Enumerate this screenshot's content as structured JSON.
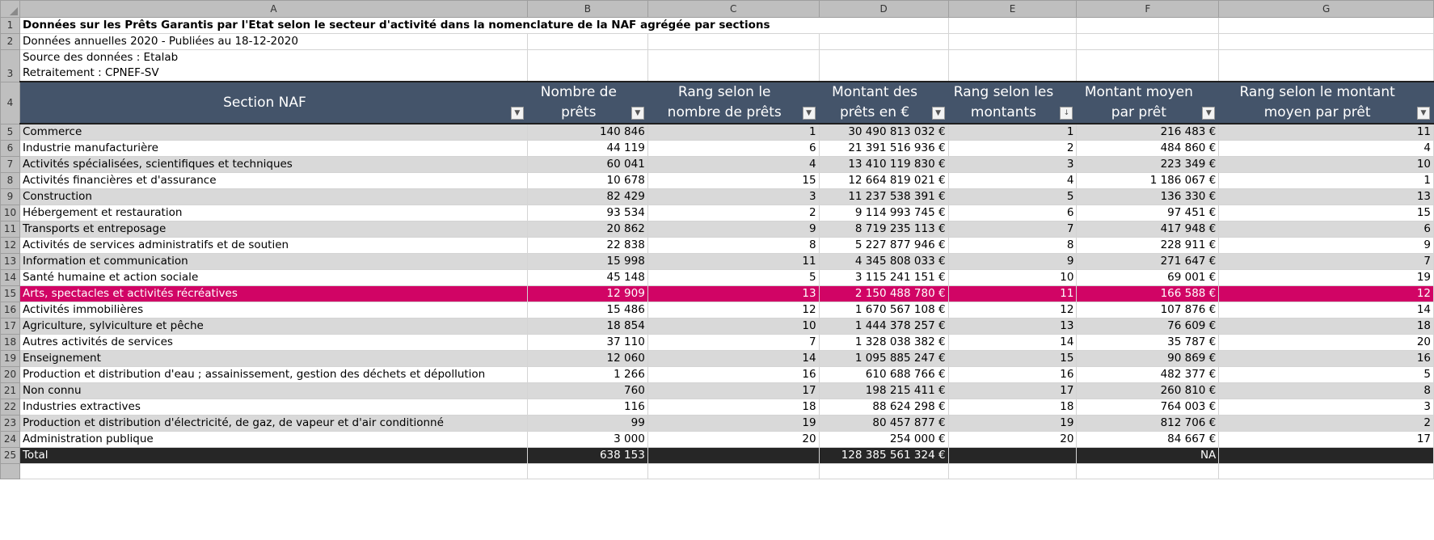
{
  "columns": [
    "A",
    "B",
    "C",
    "D",
    "E",
    "F",
    "G"
  ],
  "row_numbers": [
    "1",
    "2",
    "3",
    "4",
    "5",
    "6",
    "7",
    "8",
    "9",
    "10",
    "11",
    "12",
    "13",
    "14",
    "15",
    "16",
    "17",
    "18",
    "19",
    "20",
    "21",
    "22",
    "23",
    "24",
    "25",
    "26"
  ],
  "title": "Données sur les Prêts Garantis par l'Etat selon le secteur d'activité dans la nomenclature de la NAF agrégée par sections",
  "subtitle": "Données annuelles 2020 - Publiées au 18-12-2020",
  "source_line": "Source des données : Etalab",
  "retraitement_line": "Retraitement : CPNEF-SV",
  "headers": [
    "Section NAF",
    "Nombre de prêts",
    "Rang selon le nombre de prêts",
    "Montant des prêts en €",
    "Rang selon les montants",
    "Montant moyen par prêt",
    "Rang selon le montant moyen par prêt"
  ],
  "filter_icons": [
    "dropdown-arrow",
    "dropdown-arrow",
    "dropdown-arrow",
    "dropdown-arrow",
    "sort-descending",
    "dropdown-arrow",
    "dropdown-arrow"
  ],
  "rows": [
    {
      "section": "Commerce",
      "nombre": "140 846",
      "rang_nombre": "1",
      "montant": "30 490 813 032 €",
      "rang_montant": "1",
      "moyen": "216 483 €",
      "rang_moyen": "11"
    },
    {
      "section": "Industrie manufacturière",
      "nombre": "44 119",
      "rang_nombre": "6",
      "montant": "21 391 516 936 €",
      "rang_montant": "2",
      "moyen": "484 860 €",
      "rang_moyen": "4"
    },
    {
      "section": "Activités spécialisées, scientifiques et techniques",
      "nombre": "60 041",
      "rang_nombre": "4",
      "montant": "13 410 119 830 €",
      "rang_montant": "3",
      "moyen": "223 349 €",
      "rang_moyen": "10"
    },
    {
      "section": "Activités financières et d'assurance",
      "nombre": "10 678",
      "rang_nombre": "15",
      "montant": "12 664 819 021 €",
      "rang_montant": "4",
      "moyen": "1 186 067 €",
      "rang_moyen": "1"
    },
    {
      "section": "Construction",
      "nombre": "82 429",
      "rang_nombre": "3",
      "montant": "11 237 538 391 €",
      "rang_montant": "5",
      "moyen": "136 330 €",
      "rang_moyen": "13"
    },
    {
      "section": "Hébergement et restauration",
      "nombre": "93 534",
      "rang_nombre": "2",
      "montant": "9 114 993 745 €",
      "rang_montant": "6",
      "moyen": "97 451 €",
      "rang_moyen": "15"
    },
    {
      "section": "Transports et entreposage",
      "nombre": "20 862",
      "rang_nombre": "9",
      "montant": "8 719 235 113 €",
      "rang_montant": "7",
      "moyen": "417 948 €",
      "rang_moyen": "6"
    },
    {
      "section": "Activités de services administratifs et de soutien",
      "nombre": "22 838",
      "rang_nombre": "8",
      "montant": "5 227 877 946 €",
      "rang_montant": "8",
      "moyen": "228 911 €",
      "rang_moyen": "9"
    },
    {
      "section": "Information et communication",
      "nombre": "15 998",
      "rang_nombre": "11",
      "montant": "4 345 808 033 €",
      "rang_montant": "9",
      "moyen": "271 647 €",
      "rang_moyen": "7"
    },
    {
      "section": "Santé humaine et action sociale",
      "nombre": "45 148",
      "rang_nombre": "5",
      "montant": "3 115 241 151 €",
      "rang_montant": "10",
      "moyen": "69 001 €",
      "rang_moyen": "19"
    },
    {
      "section": "Arts, spectacles et activités récréatives",
      "nombre": "12 909",
      "rang_nombre": "13",
      "montant": "2 150 488 780 €",
      "rang_montant": "11",
      "moyen": "166 588 €",
      "rang_moyen": "12"
    },
    {
      "section": "Activités immobilières",
      "nombre": "15 486",
      "rang_nombre": "12",
      "montant": "1 670 567 108 €",
      "rang_montant": "12",
      "moyen": "107 876 €",
      "rang_moyen": "14"
    },
    {
      "section": "Agriculture, sylviculture et pêche",
      "nombre": "18 854",
      "rang_nombre": "10",
      "montant": "1 444 378 257 €",
      "rang_montant": "13",
      "moyen": "76 609 €",
      "rang_moyen": "18"
    },
    {
      "section": "Autres activités de services",
      "nombre": "37 110",
      "rang_nombre": "7",
      "montant": "1 328 038 382 €",
      "rang_montant": "14",
      "moyen": "35 787 €",
      "rang_moyen": "20"
    },
    {
      "section": "Enseignement",
      "nombre": "12 060",
      "rang_nombre": "14",
      "montant": "1 095 885 247 €",
      "rang_montant": "15",
      "moyen": "90 869 €",
      "rang_moyen": "16"
    },
    {
      "section": "Production et distribution d'eau ; assainissement, gestion des déchets et dépollution",
      "nombre": "1 266",
      "rang_nombre": "16",
      "montant": "610 688 766 €",
      "rang_montant": "16",
      "moyen": "482 377 €",
      "rang_moyen": "5"
    },
    {
      "section": "Non connu",
      "nombre": "760",
      "rang_nombre": "17",
      "montant": "198 215 411 €",
      "rang_montant": "17",
      "moyen": "260 810 €",
      "rang_moyen": "8"
    },
    {
      "section": "Industries extractives",
      "nombre": "116",
      "rang_nombre": "18",
      "montant": "88 624 298 €",
      "rang_montant": "18",
      "moyen": "764 003 €",
      "rang_moyen": "3"
    },
    {
      "section": "Production et distribution d'électricité, de gaz, de vapeur et d'air conditionné",
      "nombre": "99",
      "rang_nombre": "19",
      "montant": "80 457 877 €",
      "rang_montant": "19",
      "moyen": "812 706 €",
      "rang_moyen": "2"
    },
    {
      "section": "Administration publique",
      "nombre": "3 000",
      "rang_nombre": "20",
      "montant": "254 000 €",
      "rang_montant": "20",
      "moyen": "84 667 €",
      "rang_moyen": "17"
    }
  ],
  "total": {
    "label": "Total",
    "nombre": "638 153",
    "rang_nombre": "",
    "montant": "128 385 561 324 €",
    "rang_montant": "",
    "moyen": "NA",
    "rang_moyen": ""
  },
  "highlight_row": 15,
  "colors": {
    "header_bg": "#44546a",
    "band": "#d9d9d9",
    "highlight": "#d10465",
    "total_bg": "#262626",
    "chrome": "#bfbfbf"
  }
}
